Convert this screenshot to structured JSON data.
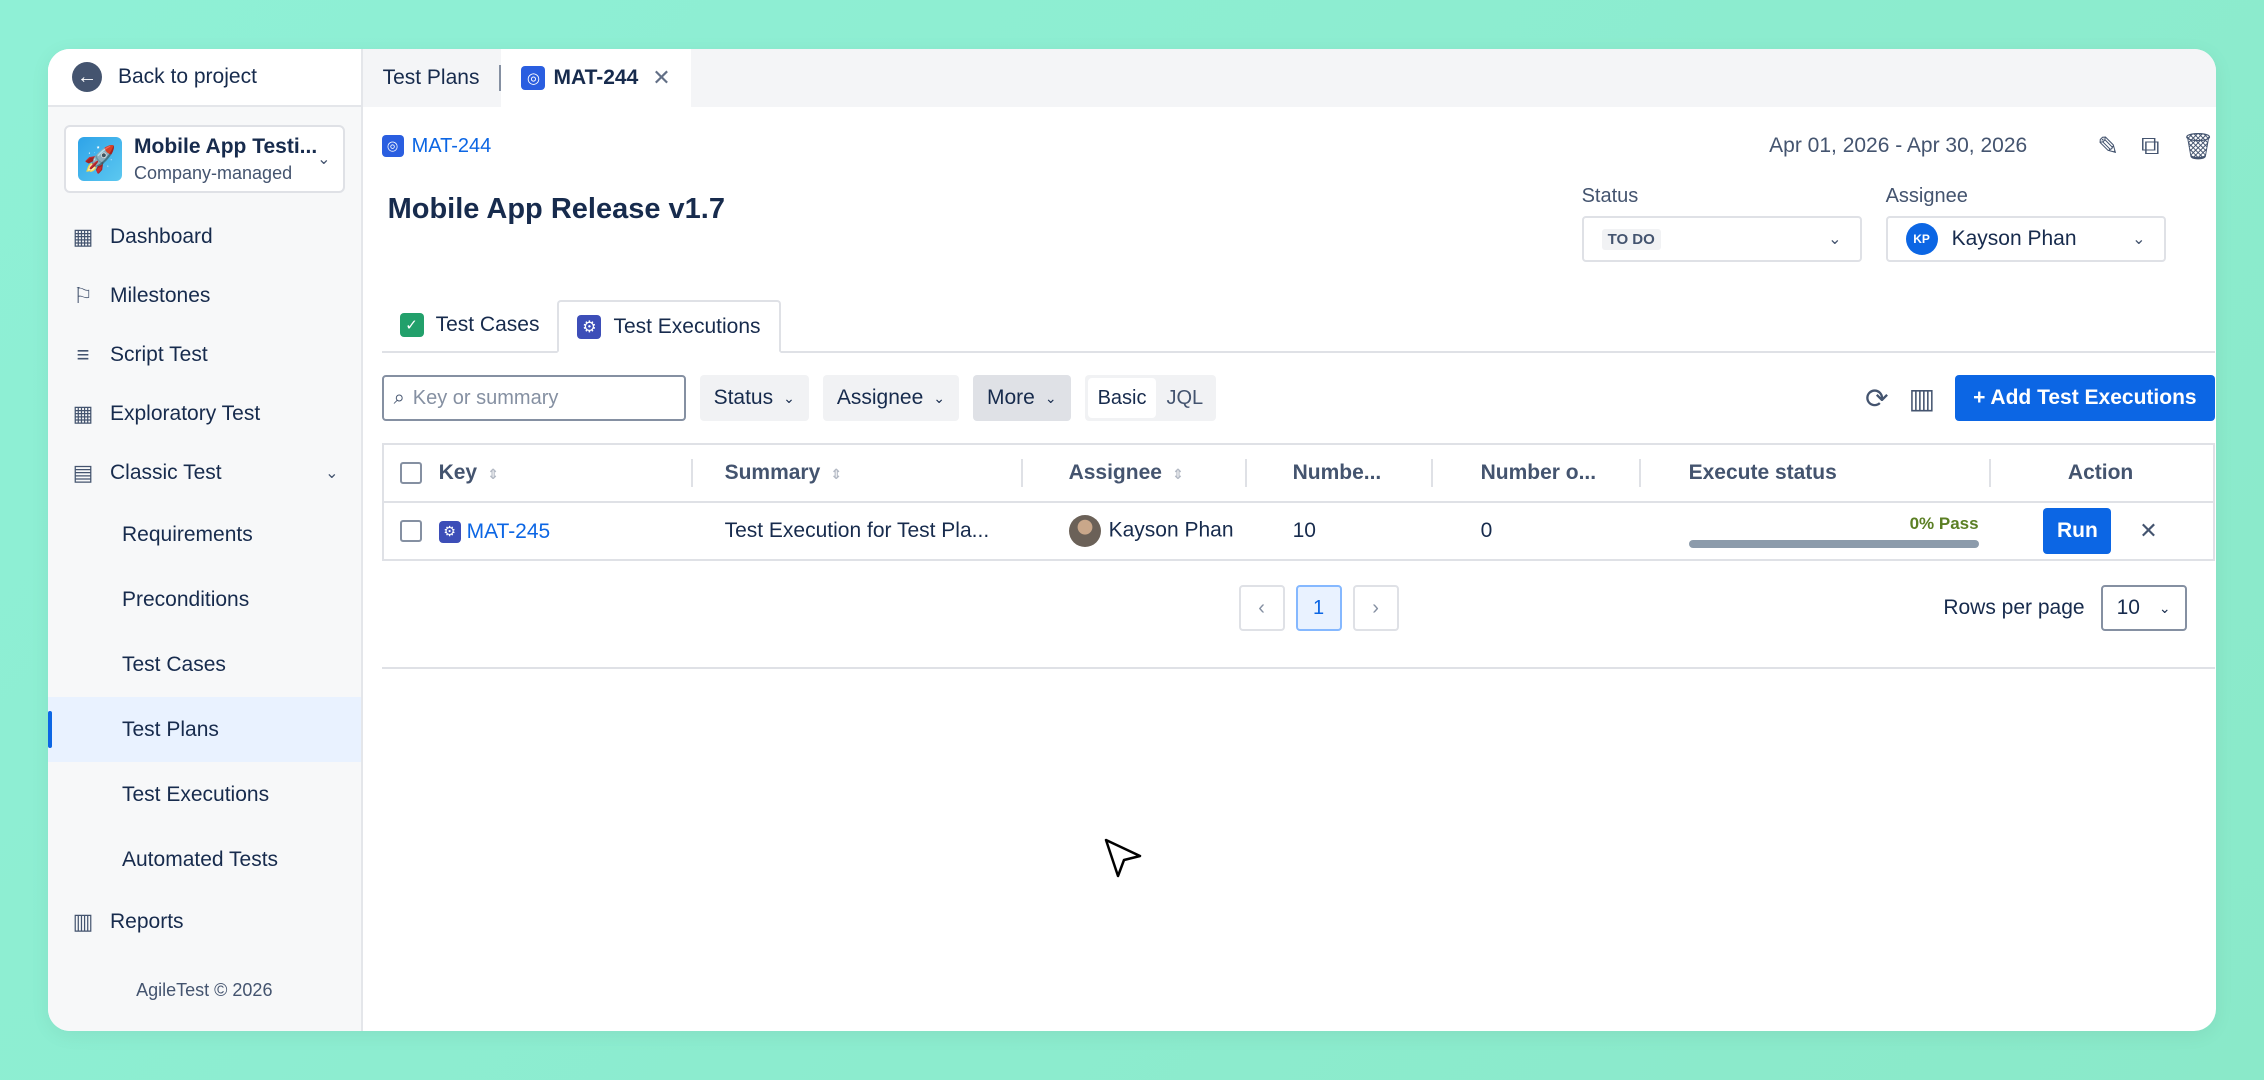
{
  "colors": {
    "accent": "#0c66e4",
    "pass": "#5b7f24",
    "background": "#8ff0d6"
  },
  "sidebar": {
    "back_label": "Back to project",
    "project": {
      "name": "Mobile App Testi...",
      "type": "Company-managed"
    },
    "items": [
      {
        "label": "Dashboard",
        "icon": "dashboard-icon"
      },
      {
        "label": "Milestones",
        "icon": "flag-icon"
      },
      {
        "label": "Script Test",
        "icon": "script-icon"
      },
      {
        "label": "Exploratory Test",
        "icon": "grid-icon"
      },
      {
        "label": "Classic Test",
        "icon": "list-icon"
      }
    ],
    "sub_items": [
      {
        "label": "Requirements"
      },
      {
        "label": "Preconditions"
      },
      {
        "label": "Test Cases"
      },
      {
        "label": "Test Plans",
        "active": true
      },
      {
        "label": "Test Executions"
      },
      {
        "label": "Automated Tests"
      }
    ],
    "reports_label": "Reports",
    "footer": "AgileTest © 2026"
  },
  "tabs": [
    {
      "label": "Test Plans"
    },
    {
      "label": "MAT-244",
      "active": true
    }
  ],
  "plan": {
    "key": "MAT-244",
    "date_range": "Apr 01, 2026 - Apr 30, 2026",
    "title": "Mobile App Release v1.7",
    "status_label": "Status",
    "status_value": "TO DO",
    "assignee_label": "Assignee",
    "assignee_initials": "KP",
    "assignee_value": "Kayson Phan"
  },
  "subtabs": [
    {
      "label": "Test Cases"
    },
    {
      "label": "Test Executions",
      "active": true
    }
  ],
  "toolbar": {
    "search_placeholder": "Key or summary",
    "status_filter": "Status",
    "assignee_filter": "Assignee",
    "more_filter": "More",
    "mode_basic": "Basic",
    "mode_jql": "JQL",
    "add_button": "+ Add Test Executions"
  },
  "table": {
    "columns": [
      "Key",
      "Summary",
      "Assignee",
      "Numbe...",
      "Number o...",
      "Execute status",
      "Action"
    ],
    "rows": [
      {
        "key": "MAT-245",
        "summary": "Test Execution for Test Pla...",
        "assignee": "Kayson Phan",
        "number1": "10",
        "number2": "0",
        "pass_label": "0% Pass",
        "pass_fraction": 0,
        "run_label": "Run"
      }
    ]
  },
  "pagination": {
    "prev": "‹",
    "current_page": "1",
    "next": "›",
    "rows_per_page_label": "Rows per page",
    "rows_per_page": "10"
  }
}
